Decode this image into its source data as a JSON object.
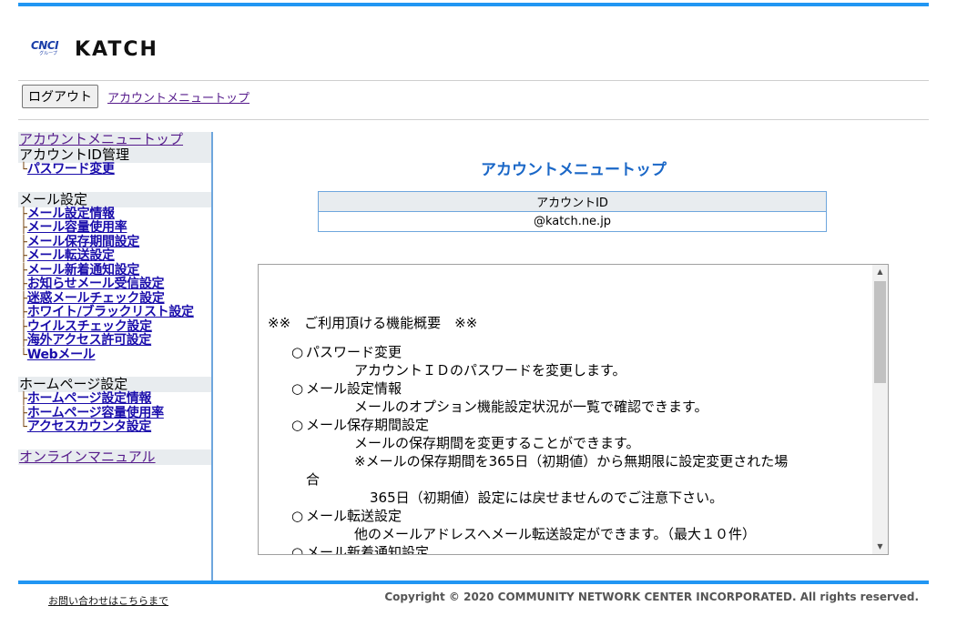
{
  "header": {
    "logo_cnci": "CNCI",
    "logo_cnci_sub": "グループ",
    "logo_katch": "KATCH"
  },
  "toolbar": {
    "logout_label": "ログアウト",
    "account_top_link": "アカウントメニュートップ"
  },
  "sidebar": {
    "account_top": "アカウントメニュートップ",
    "id_section": "アカウントID管理",
    "id_items": [
      "パスワード変更"
    ],
    "mail_section": "メール設定",
    "mail_items": [
      "メール設定情報",
      "メール容量使用率",
      "メール保存期間設定",
      "メール転送設定",
      "メール新着通知設定",
      "お知らせメール受信設定",
      "迷惑メールチェック設定",
      "ホワイト/ブラックリスト設定",
      "ウイルスチェック設定",
      "海外アクセス許可設定",
      "Webメール"
    ],
    "hp_section": "ホームページ設定",
    "hp_items": [
      "ホームページ設定情報",
      "ホームページ容量使用率",
      "アクセスカウンタ設定"
    ],
    "manual": "オンラインマニュアル"
  },
  "main": {
    "title": "アカウントメニュートップ",
    "account_table": {
      "header": "アカウントID",
      "value": "@katch.ne.jp"
    },
    "info": {
      "heading": "※※　ご利用頂ける機能概要　※※",
      "f1": "パスワード変更",
      "f1_desc": "アカウントＩＤのパスワードを変更します。",
      "f2": "メール設定情報",
      "f2_desc": "メールのオプション機能設定状況が一覧で確認できます。",
      "f3": "メール保存期間設定",
      "f3_desc": "メールの保存期間を変更することができます。",
      "f3_note": "※メールの保存期間を365日（初期値）から無期限に設定変更された場",
      "f3_note_wrap": "合",
      "f3_note2": "365日（初期値）設定には戻せませんのでご注意下さい。",
      "f4": "メール転送設定",
      "f4_desc": "他のメールアドレスへメール転送設定ができます。（最大１０件）",
      "f5": "メール新着通知設定"
    }
  },
  "footer": {
    "contact_link": "お問い合わせはこちらまで",
    "copyright": "Copyright © 2020 COMMUNITY NETWORK CENTER INCORPORATED. All rights reserved."
  },
  "colors": {
    "accent_bar": "#2196f3",
    "title_blue": "#1a67c7",
    "tree_brown": "#7a4b19"
  }
}
